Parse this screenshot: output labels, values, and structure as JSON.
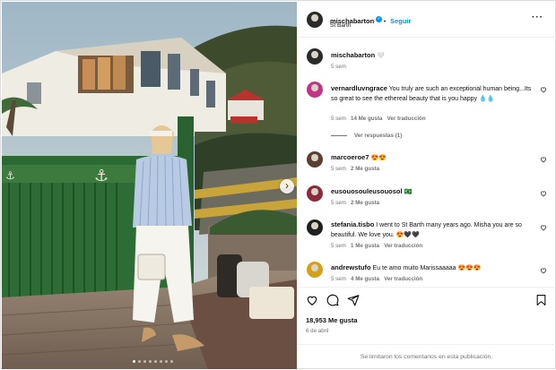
{
  "post": {
    "username": "mischabarton",
    "follow_label": "Seguir",
    "location": "St Barth",
    "caption_username": "mischabarton",
    "caption_text": "🤍",
    "caption_time": "5 sem",
    "likes": "18,953 Me gusta",
    "date": "6 de abril",
    "comments_disabled": "Se limitaron los comentarios en esta publicación."
  },
  "comments": [
    {
      "username": "vernardluvngrace",
      "text": "You truly are such an exceptional human being...Its so great to see the ethereal beauty that is you happy 💧💧",
      "time": "5 sem",
      "likes": "14 Me gusta",
      "translate": "Ver traducción",
      "replies": "Ver respuestas (1)"
    },
    {
      "username": "marcoeroe7",
      "text": "😍😍",
      "time": "5 sem",
      "likes": "2 Me gusta",
      "translate": ""
    },
    {
      "username": "eusouosouleusouosol",
      "text": "🇧🇷",
      "time": "5 sem",
      "likes": "2 Me gusta",
      "translate": ""
    },
    {
      "username": "stefania.tisbo",
      "text": "I went to St Barth many years ago. Misha you are so beautiful. We love you. 😍🖤🖤",
      "time": "5 sem",
      "likes": "1 Me gusta",
      "translate": "Ver traducción"
    },
    {
      "username": "andrewstufo",
      "text": "Eu te amo muito Marissaaaaa 😍😍😍",
      "time": "5 sem",
      "likes": "4 Me gusta",
      "translate": "Ver traducción"
    }
  ],
  "carousel": {
    "slides": 8,
    "active": 1
  },
  "colors": {
    "accent": "#0095f6",
    "muted": "#737373",
    "gate": "#2c6a33"
  },
  "icons": [
    "heart-icon",
    "comment-icon",
    "share-icon",
    "bookmark-icon",
    "more-icon",
    "verified-icon",
    "next-icon"
  ]
}
